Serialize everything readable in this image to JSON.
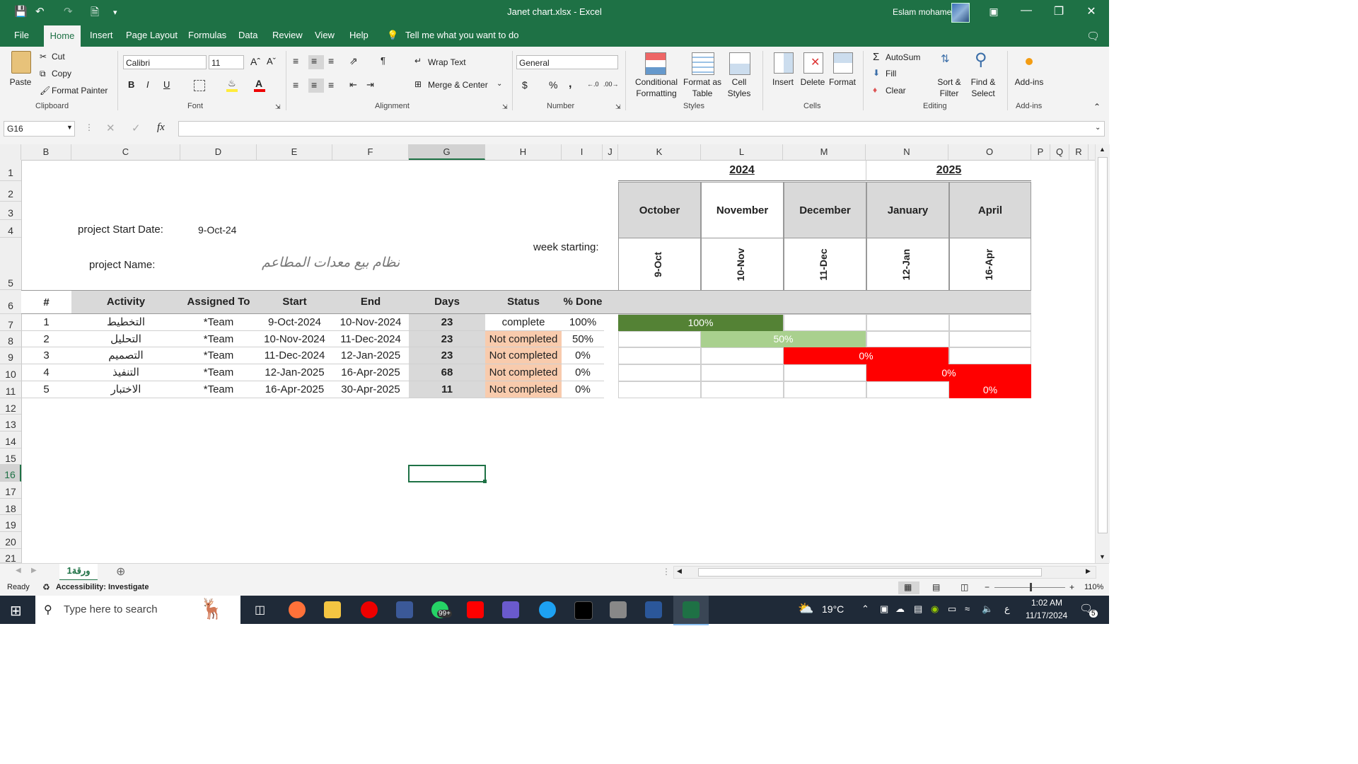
{
  "window": {
    "title": "Janet chart.xlsx  -  Excel",
    "user": "Eslam mohamed"
  },
  "tabs": [
    "File",
    "Home",
    "Insert",
    "Page Layout",
    "Formulas",
    "Data",
    "Review",
    "View",
    "Help"
  ],
  "tell_me": "Tell me what you want to do",
  "ribbon": {
    "clipboard": {
      "paste": "Paste",
      "cut": "Cut",
      "copy": "Copy",
      "format_painter": "Format Painter",
      "label": "Clipboard"
    },
    "font": {
      "name": "Calibri",
      "size": "11",
      "bold": "B",
      "italic": "I",
      "underline": "U",
      "label": "Font"
    },
    "alignment": {
      "wrap": "Wrap Text",
      "merge": "Merge & Center",
      "label": "Alignment"
    },
    "number": {
      "format": "General",
      "currency": "$",
      "percent": "%",
      "comma": ",",
      "label": "Number"
    },
    "styles": {
      "conditional": "Conditional",
      "conditional2": "Formatting",
      "format_table": "Format as",
      "format_table2": "Table",
      "cell_styles": "Cell",
      "cell_styles2": "Styles",
      "label": "Styles"
    },
    "cells": {
      "insert": "Insert",
      "delete": "Delete",
      "format": "Format",
      "label": "Cells"
    },
    "editing": {
      "autosum": "AutoSum",
      "fill": "Fill",
      "clear": "Clear",
      "sort": "Sort &",
      "sort2": "Filter",
      "find": "Find &",
      "find2": "Select",
      "label": "Editing"
    },
    "addins": {
      "addins": "Add-ins",
      "label": "Add-ins"
    }
  },
  "formula_bar": {
    "name_box": "G16",
    "fx": "fx",
    "formula": ""
  },
  "columns": [
    "B",
    "C",
    "D",
    "E",
    "F",
    "G",
    "H",
    "I",
    "J",
    "K",
    "L",
    "M",
    "N",
    "O",
    "P",
    "Q",
    "R"
  ],
  "rows": [
    "1",
    "2",
    "3",
    "4",
    "5",
    "6",
    "7",
    "8",
    "9",
    "10",
    "11",
    "12",
    "13",
    "14",
    "15",
    "16",
    "17",
    "18",
    "19",
    "20",
    "21"
  ],
  "project": {
    "start_label": "project Start Date:",
    "start_value": "9-Oct-24",
    "name_label": "project Name:",
    "name_value": "نظام بيع معدات المطاعم",
    "week_label": "week starting:"
  },
  "years": [
    "2024",
    "2025"
  ],
  "months": [
    "October",
    "November",
    "December",
    "January",
    "April"
  ],
  "weeks": [
    "9-Oct",
    "10-Nov",
    "11-Dec",
    "12-Jan",
    "16-Apr"
  ],
  "table": {
    "headers": [
      "#",
      "Activity",
      "Assigned To",
      "Start",
      "End",
      "Days",
      "Status",
      "% Done"
    ],
    "rows": [
      [
        "1",
        "التخطيط",
        "*Team",
        "9-Oct-2024",
        "10-Nov-2024",
        "23",
        "complete",
        "100%"
      ],
      [
        "2",
        "التحليل",
        "*Team",
        "10-Nov-2024",
        "11-Dec-2024",
        "23",
        "Not completed",
        "50%"
      ],
      [
        "3",
        "التصميم",
        "*Team",
        "11-Dec-2024",
        "12-Jan-2025",
        "23",
        "Not completed",
        "0%"
      ],
      [
        "4",
        "التنفيذ",
        "*Team",
        "12-Jan-2025",
        "16-Apr-2025",
        "68",
        "Not completed",
        "0%"
      ],
      [
        "5",
        "الاختبار",
        "*Team",
        "16-Apr-2025",
        "30-Apr-2025",
        "11",
        "Not completed",
        "0%"
      ]
    ]
  },
  "gantt": [
    {
      "label": "100%",
      "color": "#548235",
      "text_color": "#ffffff"
    },
    {
      "label": "50%",
      "color": "#a9d08e",
      "text_color": "#ffffff"
    },
    {
      "label": "0%",
      "color": "#ff0000",
      "text_color": "#ffffff"
    },
    {
      "label": "0%",
      "color": "#ff0000",
      "text_color": "#ffffff"
    },
    {
      "label": "0%",
      "color": "#ff0000",
      "text_color": "#ffffff"
    }
  ],
  "sheet_tab": "ورقة1",
  "status": {
    "ready": "Ready",
    "accessibility": "Accessibility: Investigate",
    "zoom": "110%"
  },
  "taskbar": {
    "search": "Type here to search",
    "weather": "19°C",
    "time": "1:02 AM",
    "date": "11/17/2024",
    "badge": "99+",
    "lang": "ع",
    "notif": "5"
  }
}
